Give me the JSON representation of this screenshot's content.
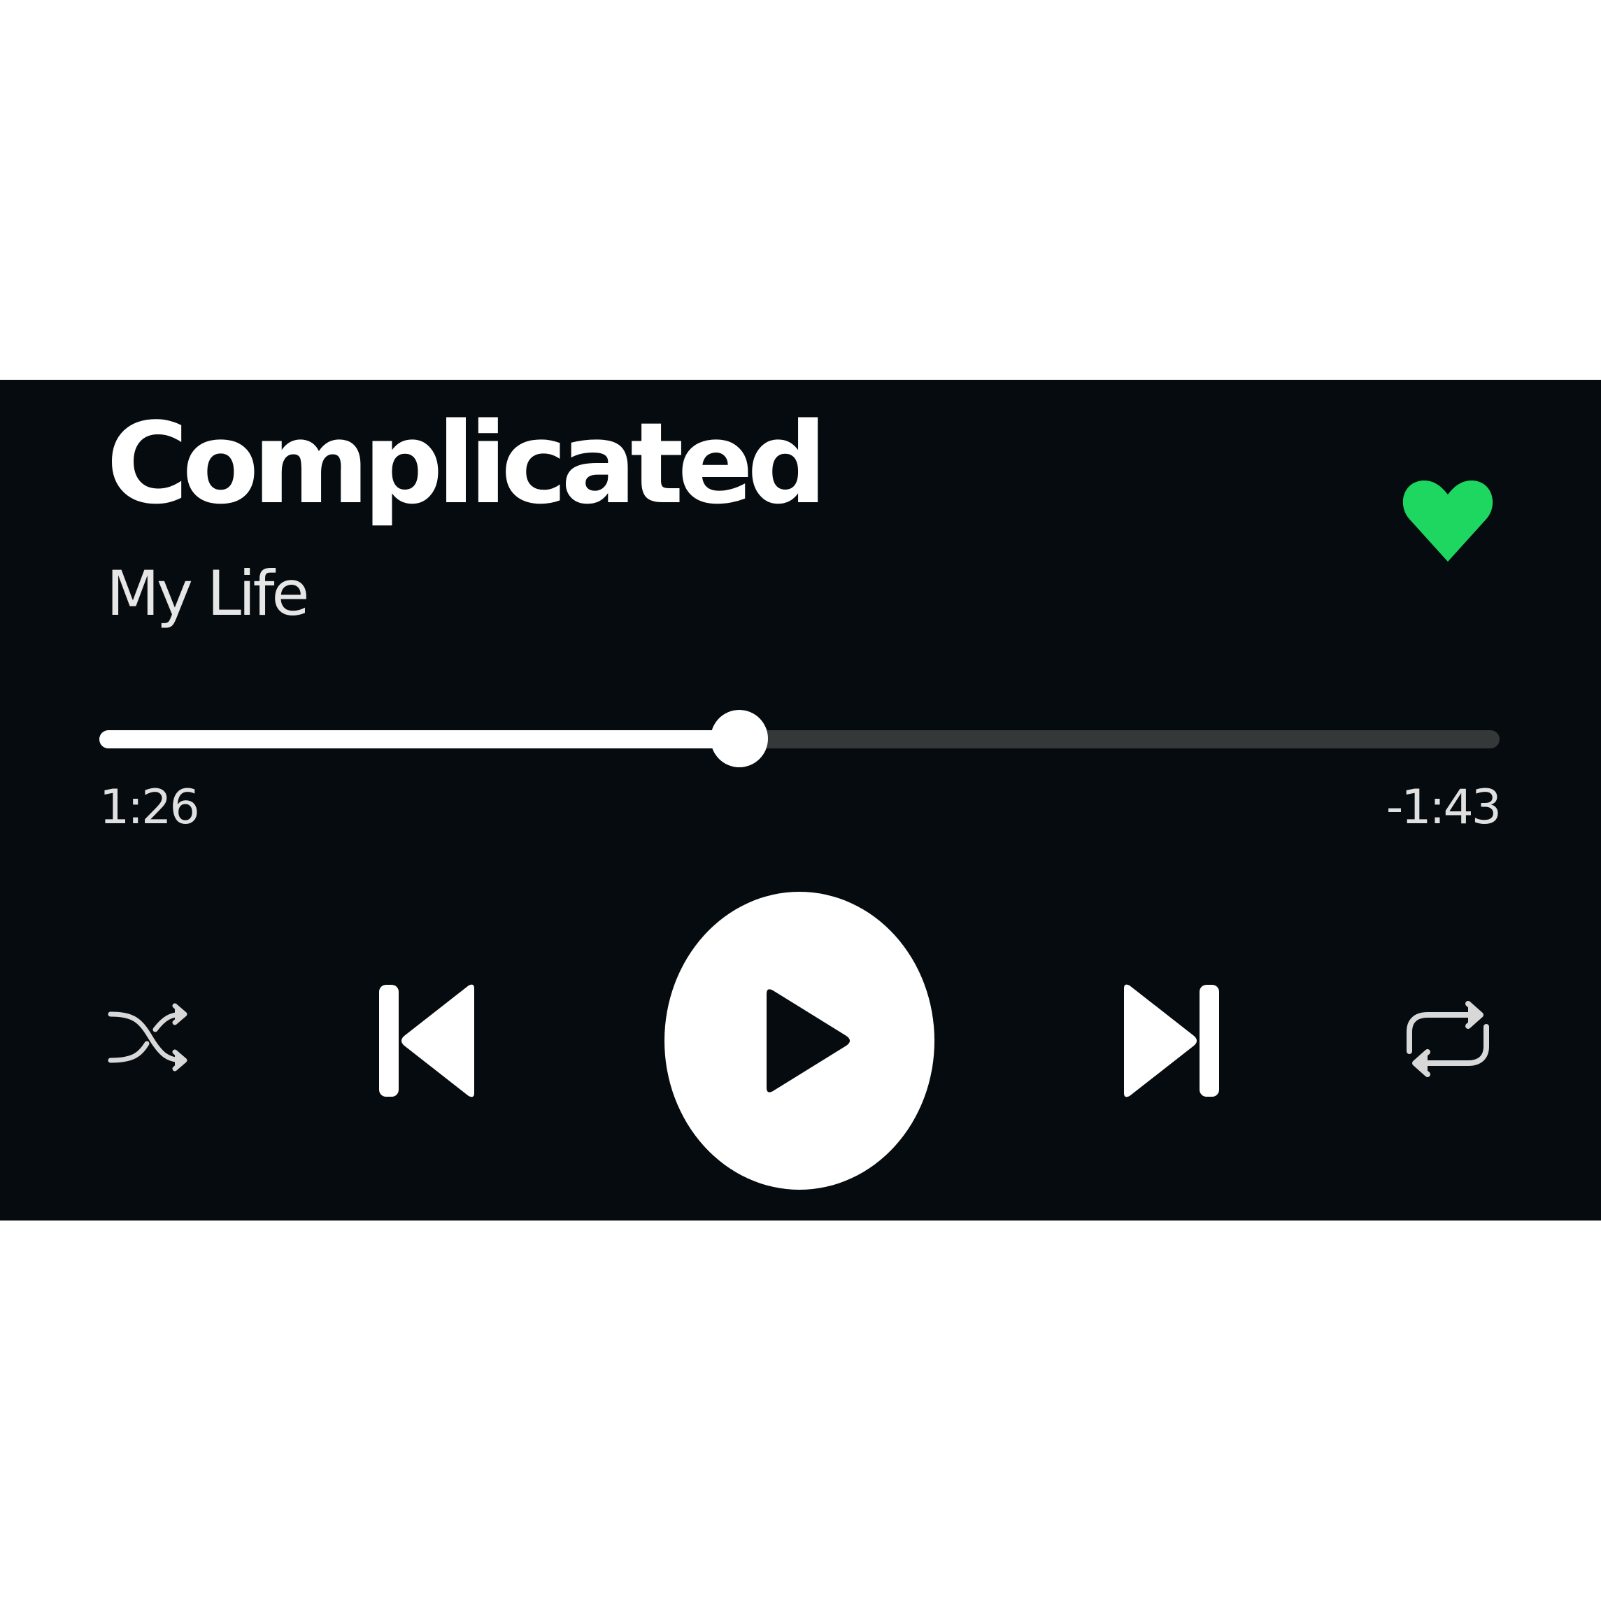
{
  "track": {
    "title": "Complicated",
    "subtitle": "My Life",
    "liked": true
  },
  "playback": {
    "progress": 0.457,
    "elapsed": "1:26",
    "remaining": "-1:43",
    "state": "paused"
  },
  "controls": {
    "shuffle_icon": "shuffle-icon",
    "previous_icon": "skip-previous-icon",
    "play_icon": "play-icon",
    "next_icon": "skip-next-icon",
    "repeat_icon": "repeat-icon",
    "like_icon": "heart-icon"
  },
  "colors": {
    "background": "#050b0e",
    "accent": "#1ed760",
    "track_remaining": "#353839",
    "foreground": "#ffffff"
  }
}
